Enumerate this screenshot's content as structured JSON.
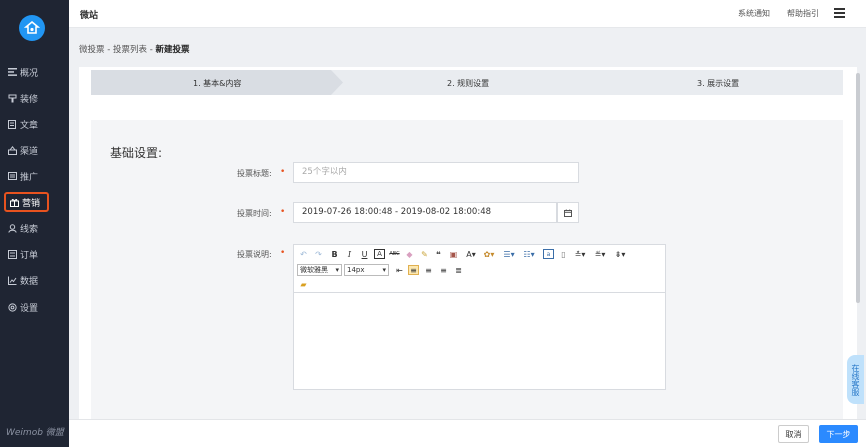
{
  "app": {
    "title": "微站",
    "brand": "Weimob 微盟"
  },
  "header": {
    "notice": "系统通知",
    "help": "帮助指引"
  },
  "sidebar": {
    "items": [
      {
        "label": "概况",
        "icon": "dashboard-icon"
      },
      {
        "label": "装修",
        "icon": "brush-icon"
      },
      {
        "label": "文章",
        "icon": "article-icon"
      },
      {
        "label": "渠道",
        "icon": "channel-icon"
      },
      {
        "label": "推广",
        "icon": "promote-icon"
      },
      {
        "label": "营销",
        "icon": "gift-icon"
      },
      {
        "label": "线索",
        "icon": "person-icon"
      },
      {
        "label": "订单",
        "icon": "order-icon"
      },
      {
        "label": "数据",
        "icon": "chart-icon"
      },
      {
        "label": "设置",
        "icon": "gear-icon"
      }
    ],
    "active": "营销"
  },
  "breadcrumb": {
    "part1": "微投票",
    "part2": "投票列表",
    "current": "新建投票",
    "sep": " - "
  },
  "steps": [
    "1. 基本&内容",
    "2. 规则设置",
    "3. 展示设置"
  ],
  "form": {
    "section_title": "基础设置:",
    "title_label": "投票标题:",
    "title_placeholder": "25个字以内",
    "time_label": "投票时间:",
    "time_value": "2019-07-26 18:00:48 - 2019-08-02 18:00:48",
    "desc_label": "投票说明:",
    "required_mark": "•",
    "font_family": "微软雅黑",
    "font_size": "14px"
  },
  "footer": {
    "cancel": "取消",
    "next": "下一步"
  },
  "service": "在线客服",
  "colors": {
    "accent": "#2b8aff",
    "active_border": "#e8531f",
    "sidebar_bg": "#1f2533"
  }
}
